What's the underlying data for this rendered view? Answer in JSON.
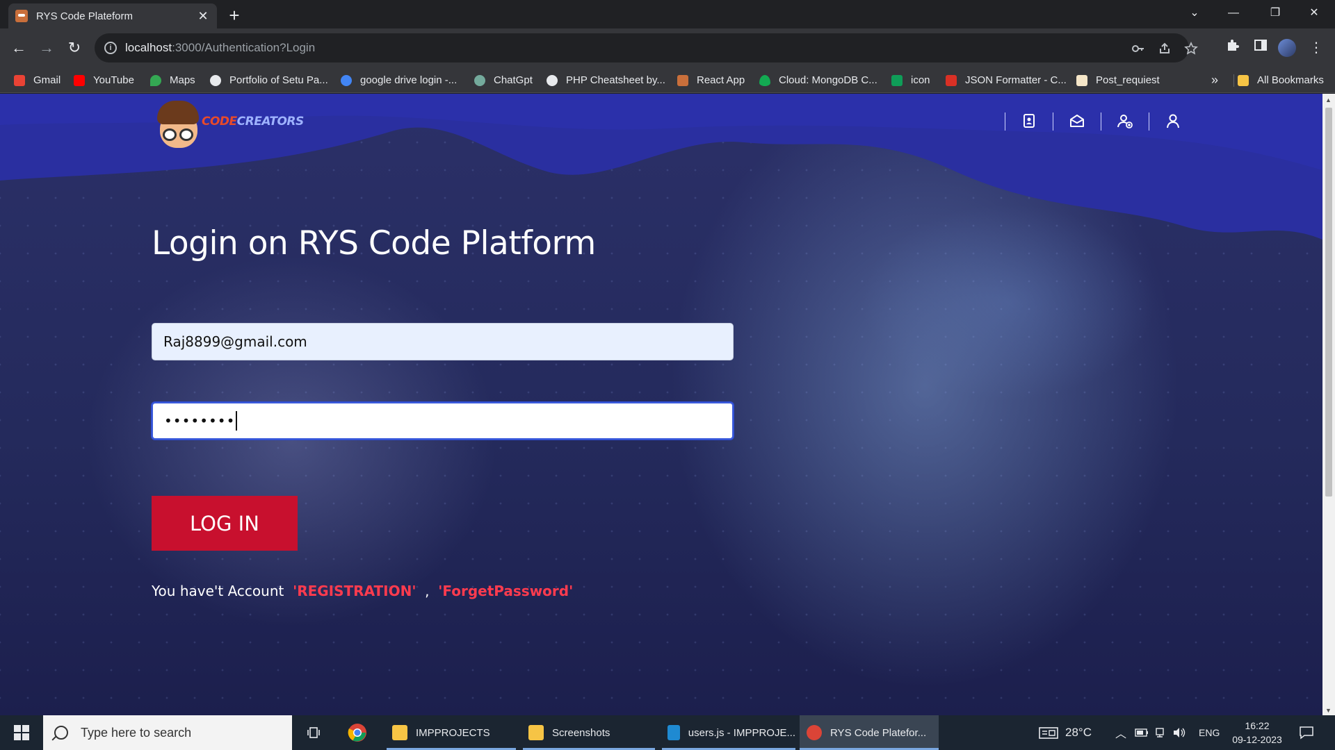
{
  "browser": {
    "tab_title": "RYS Code Plateform",
    "tab_close": "✕",
    "new_tab": "+",
    "window_controls": {
      "dropdown": "⌄",
      "minimize": "—",
      "restore": "❐",
      "close": "✕"
    },
    "nav": {
      "back": "←",
      "forward": "→",
      "reload": "↻"
    },
    "url_host": "localhost",
    "url_path": ":3000/Authentication?Login",
    "bookmarks": [
      {
        "label": "Gmail",
        "color": "#ea4335"
      },
      {
        "label": "YouTube",
        "color": "#ff0000"
      },
      {
        "label": "Maps",
        "color": "#34a853"
      },
      {
        "label": "Portfolio of Setu Pa...",
        "color": "#e8eaed"
      },
      {
        "label": "google drive login -...",
        "color": "#4285f4"
      },
      {
        "label": "ChatGpt",
        "color": "#74aa9c"
      },
      {
        "label": "PHP Cheatsheet by...",
        "color": "#e8eaed"
      },
      {
        "label": "React App",
        "color": "#c96f3b"
      },
      {
        "label": "Cloud: MongoDB C...",
        "color": "#13aa52"
      },
      {
        "label": "icon",
        "color": "#0f9d58"
      },
      {
        "label": "JSON Formatter - C...",
        "color": "#d93025"
      },
      {
        "label": "Post_requiest",
        "color": "#f5e6c8"
      }
    ],
    "bookmarks_overflow": "»",
    "all_bookmarks": "All Bookmarks"
  },
  "page": {
    "logo": {
      "part1": "CODE",
      "part2": "CREATORS"
    },
    "heading": "Login on RYS Code Platform",
    "email_value": "Raj8899@gmail.com",
    "password_value": "••••••••",
    "login_label": "LOG IN",
    "register_prefix": "You have't Account",
    "register_link": "'REGISTRATION'",
    "register_sep": ",",
    "forget_link": "'ForgetPassword'"
  },
  "taskbar": {
    "search_placeholder": "Type here to search",
    "apps": [
      {
        "label": "IMPPROJECTS"
      },
      {
        "label": "Screenshots"
      },
      {
        "label": "users.js - IMPPROJE..."
      },
      {
        "label": "RYS Code Platefor..."
      }
    ],
    "weather": "28°C",
    "language": "ENG",
    "time": "16:22",
    "date": "09-12-2023"
  }
}
